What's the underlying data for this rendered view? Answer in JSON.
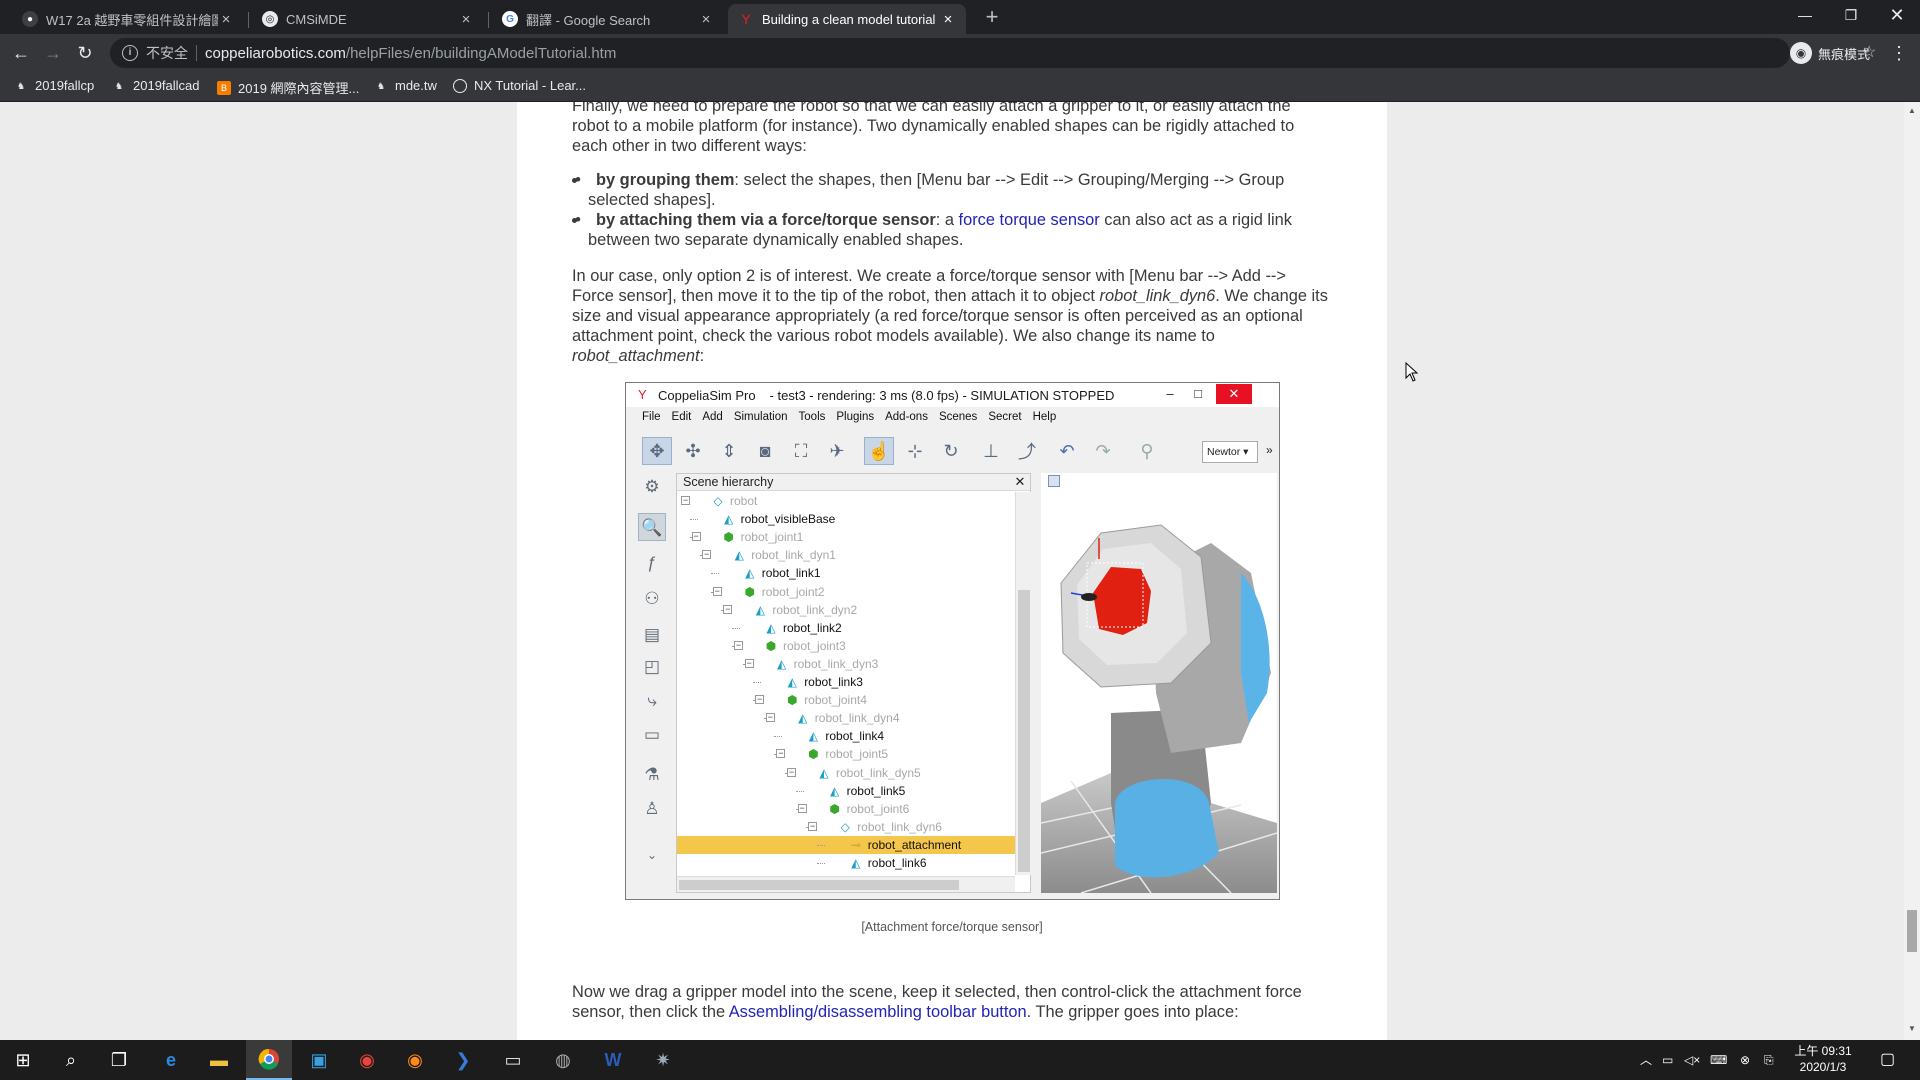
{
  "browser": {
    "tabs": [
      {
        "title": "W17 2a 越野車零組件設計繪圖",
        "active": false
      },
      {
        "title": "CMSiMDE",
        "active": false
      },
      {
        "title": "翻譯 - Google Search",
        "active": false
      },
      {
        "title": "Building a clean model tutorial",
        "active": true
      }
    ],
    "address": {
      "security_label": "不安全",
      "host": "coppeliarobotics.com",
      "path": "/helpFiles/en/buildingAModelTutorial.htm"
    },
    "incognito_label": "無痕模式",
    "bookmarks": [
      "2019fallcp",
      "2019fallcad",
      "2019 網際內容管理...",
      "mde.tw",
      "NX Tutorial - Lear..."
    ]
  },
  "article": {
    "para1": {
      "text": "Finally, we need to prepare the robot so that we can easily attach a gripper to it, or easily attach the robot to a mobile platform (for instance). Two dynamically enabled shapes can be rigidly attached to each other in two different ways:"
    },
    "bullet1": {
      "strong": "by grouping them",
      "text": ": select the shapes, then [Menu bar --> Edit --> Grouping/Merging --> Group selected shapes]."
    },
    "bullet2": {
      "strong": "by attaching them via a force/torque sensor",
      "before_link": ": a ",
      "link": "force torque sensor",
      "after_link": " can also act as a rigid link between two separate dynamically enabled shapes."
    },
    "para2": {
      "before": "In our case, only option 2 is of interest. We create a force/torque sensor with [Menu bar --> Add --> Force sensor], then move it to the tip of the robot, then attach it to object ",
      "em1": "robot_link_dyn6",
      "middle": ". We change its size and visual appearance appropriately (a red force/torque sensor is often perceived as an optional attachment point, check the various robot models available). We also change its name to ",
      "em2": "robot_attachment",
      "end": ":"
    },
    "caption": "[Attachment force/torque sensor]",
    "para3": {
      "before": "Now we drag a gripper model into the scene, keep it selected, then control-click the attachment force sensor, then click the ",
      "link": "Assembling/disassembling toolbar button",
      "after": ". The gripper goes into place:"
    }
  },
  "coppelia": {
    "app_name": "CoppeliaSim Pro",
    "window_title": "- test3 - rendering: 3 ms (8.0 fps) - SIMULATION STOPPED",
    "menus": [
      "File",
      "Edit",
      "Add",
      "Simulation",
      "Tools",
      "Plugins",
      "Add-ons",
      "Scenes",
      "Secret",
      "Help"
    ],
    "engine_select": "Newtor",
    "panel_title": "Scene hierarchy",
    "tree": [
      {
        "name": "robot",
        "depth": 0,
        "type": "model",
        "dim": true,
        "expander": "⊟"
      },
      {
        "name": "robot_visibleBase",
        "depth": 1,
        "type": "shape",
        "dim": false,
        "expander": ""
      },
      {
        "name": "robot_joint1",
        "depth": 1,
        "type": "joint",
        "dim": true,
        "expander": "⊟"
      },
      {
        "name": "robot_link_dyn1",
        "depth": 2,
        "type": "shape",
        "dim": true,
        "expander": "⊟"
      },
      {
        "name": "robot_link1",
        "depth": 3,
        "type": "shape",
        "dim": false,
        "expander": ""
      },
      {
        "name": "robot_joint2",
        "depth": 3,
        "type": "joint",
        "dim": true,
        "expander": "⊟"
      },
      {
        "name": "robot_link_dyn2",
        "depth": 4,
        "type": "shape",
        "dim": true,
        "expander": "⊟"
      },
      {
        "name": "robot_link2",
        "depth": 5,
        "type": "shape",
        "dim": false,
        "expander": ""
      },
      {
        "name": "robot_joint3",
        "depth": 5,
        "type": "joint",
        "dim": true,
        "expander": "⊟"
      },
      {
        "name": "robot_link_dyn3",
        "depth": 6,
        "type": "shape",
        "dim": true,
        "expander": "⊟"
      },
      {
        "name": "robot_link3",
        "depth": 7,
        "type": "shape",
        "dim": false,
        "expander": ""
      },
      {
        "name": "robot_joint4",
        "depth": 7,
        "type": "joint",
        "dim": true,
        "expander": "⊟"
      },
      {
        "name": "robot_link_dyn4",
        "depth": 8,
        "type": "shape",
        "dim": true,
        "expander": "⊟"
      },
      {
        "name": "robot_link4",
        "depth": 9,
        "type": "shape",
        "dim": false,
        "expander": ""
      },
      {
        "name": "robot_joint5",
        "depth": 9,
        "type": "joint",
        "dim": true,
        "expander": "⊟"
      },
      {
        "name": "robot_link_dyn5",
        "depth": 10,
        "type": "shape",
        "dim": true,
        "expander": "⊟"
      },
      {
        "name": "robot_link5",
        "depth": 11,
        "type": "shape",
        "dim": false,
        "expander": ""
      },
      {
        "name": "robot_joint6",
        "depth": 11,
        "type": "joint",
        "dim": true,
        "expander": "⊟"
      },
      {
        "name": "robot_link_dyn6",
        "depth": 12,
        "type": "model",
        "dim": true,
        "expander": "⊟"
      },
      {
        "name": "robot_attachment",
        "depth": 13,
        "type": "force",
        "dim": false,
        "expander": "",
        "selected": true
      },
      {
        "name": "robot_link6",
        "depth": 13,
        "type": "shape",
        "dim": false,
        "expander": ""
      }
    ]
  },
  "taskbar": {
    "clock_time": "上午 09:31",
    "clock_date": "2020/1/3"
  },
  "colors": {
    "link": "#2323b8",
    "selected_row": "#f5c64c",
    "sensor_red": "#e02010",
    "robot_gray": "#9a9a9a",
    "robot_blue": "#5ab4e8"
  }
}
